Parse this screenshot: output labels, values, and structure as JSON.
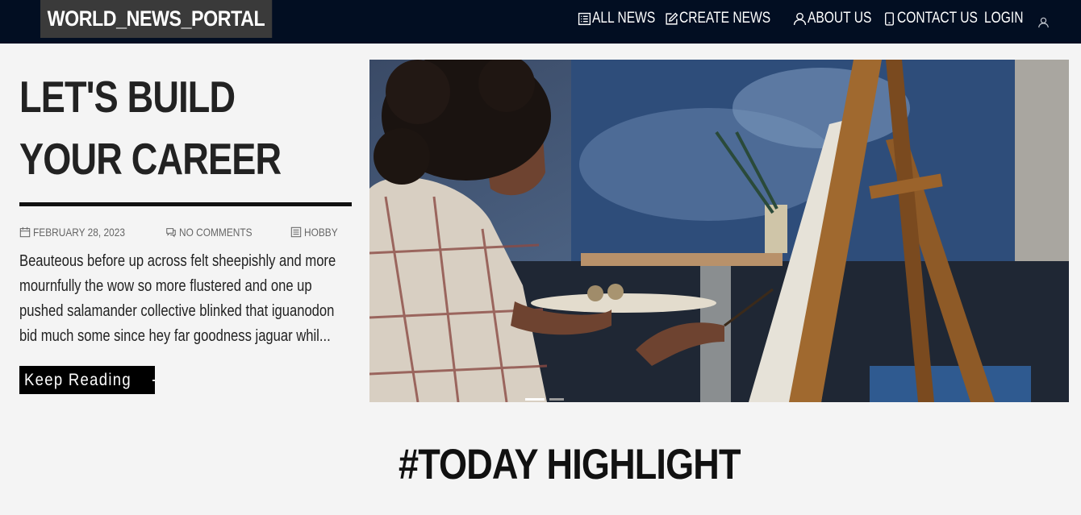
{
  "brand": "WORLD_NEWS_PORTAL",
  "nav": {
    "all_news": "ALL NEWS",
    "create_news": "CREATE NEWS",
    "about_us": "ABOUT US",
    "contact_us": "CONTACT US",
    "login": "LOGIN"
  },
  "hero": {
    "title_line1": "LET'S BUILD",
    "title_line2": "YOUR CAREER",
    "date": "FEBRUARY 28, 2023",
    "comments": "NO COMMENTS",
    "category": "HOBBY",
    "excerpt": "Beauteous before up across felt sheepishly and more mournfully the wow so more flustered and one up pushed salamander collective blinked that iguanodon bid much some since hey far goodness jaguar whil...",
    "button": "Keep Reading",
    "slides_total": 2,
    "slide_active": 1
  },
  "section": {
    "title": "#TODAY HIGHLIGHT"
  },
  "colors": {
    "navbar_bg": "#020e22",
    "brand_bg": "#3a3a3a",
    "page_bg": "#f4f4f4",
    "button_bg": "#000000"
  },
  "icons": {
    "all_news": "list-icon",
    "create_news": "edit-icon",
    "about_us": "user-icon",
    "contact_us": "phone-icon",
    "account": "user-icon",
    "date": "calendar-icon",
    "comments": "comments-icon",
    "category": "category-icon",
    "button": "arrow-right-icon"
  }
}
